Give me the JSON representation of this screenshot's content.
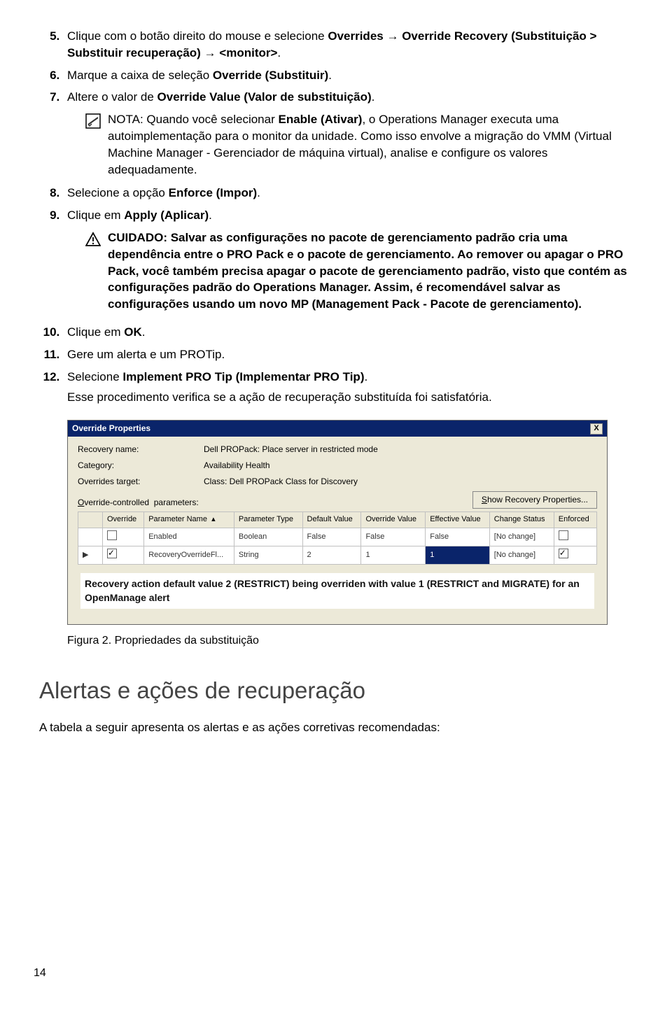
{
  "steps": {
    "s5_pre": "Clique com o botão direito do mouse e selecione ",
    "s5_b1": "Overrides",
    "s5_arrow1": " → ",
    "s5_b2": "Override Recovery (Substituição > Substituir recuperação)",
    "s5_arrow2": " → ",
    "s5_b3": "<monitor>",
    "s5_post": ".",
    "s6_pre": "Marque a caixa de seleção ",
    "s6_b": "Override (Substituir)",
    "s6_post": ".",
    "s7_pre": "Altere o valor de ",
    "s7_b": "Override Value (Valor de substituição)",
    "s7_post": ".",
    "s8_pre": "Selecione a opção ",
    "s8_b": "Enforce (Impor)",
    "s8_post": ".",
    "s9_pre": "Clique em ",
    "s9_b": "Apply (Aplicar)",
    "s9_post": ".",
    "s10_pre": "Clique em ",
    "s10_b": "OK",
    "s10_post": ".",
    "s11": "Gere um alerta e um PROTip.",
    "s12_pre": "Selecione ",
    "s12_b": "Implement PRO Tip (Implementar PRO Tip)",
    "s12_post": ".",
    "s12_sub": "Esse procedimento verifica se a ação de recuperação substituída foi satisfatória."
  },
  "note": "NOTA: Quando você selecionar Enable (Ativar), o Operations Manager executa uma autoimplementação para o monitor da unidade. Como isso envolve a migração do VMM (Virtual Machine Manager - Gerenciador de máquina virtual), analise e configure os valores adequadamente.",
  "note_bold1": "NOTA:",
  "note_bold2": "Enable (Ativar)",
  "caution": "CUIDADO: Salvar as configurações no pacote de gerenciamento padrão cria uma dependência entre o PRO Pack e o pacote de gerenciamento. Ao remover ou apagar o PRO Pack, você também precisa apagar o pacote de gerenciamento padrão, visto que contém as configurações padrão do Operations Manager. Assim, é recomendável salvar as configurações usando um novo MP (Management Pack - Pacote de gerenciamento).",
  "dialog": {
    "title": "Override Properties",
    "close": "X",
    "recovery_name_label": "Recovery name:",
    "recovery_name_value": "Dell PROPack: Place server in restricted mode",
    "category_label": "Category:",
    "category_value": "Availability Health",
    "overrides_target_label": "Overrides target:",
    "overrides_target_value": "Class: Dell PROPack Class for Discovery",
    "controlled_label": "Override-controlled  parameters:",
    "show_btn": "Show Recovery Properties...",
    "headers": [
      "",
      "Override",
      "Parameter Name",
      "Parameter Type",
      "Default Value",
      "Override Value",
      "Effective Value",
      "Change Status",
      "Enforced"
    ],
    "row1": {
      "name": "Enabled",
      "type": "Boolean",
      "def": "False",
      "ov": "False",
      "eff": "False",
      "chg": "[No change]"
    },
    "row2": {
      "name": "RecoveryOverrideFl...",
      "type": "String",
      "def": "2",
      "ov": "1",
      "eff": "1",
      "chg": "[No change]"
    },
    "caption": "Recovery action default value 2 (RESTRICT) being overriden with value 1 (RESTRICT and MIGRATE) for an OpenManage alert"
  },
  "figure_caption": "Figura 2. Propriedades da substituição",
  "section_title": "Alertas e ações de recuperação",
  "section_body": "A tabela a seguir apresenta os alertas e as ações corretivas recomendadas:",
  "page_number": "14"
}
